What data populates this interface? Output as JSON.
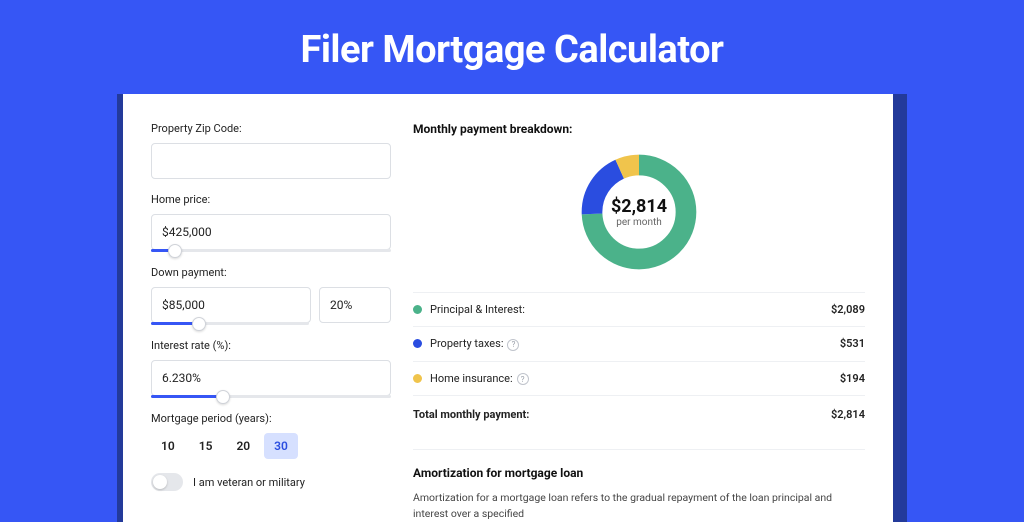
{
  "page_title": "Filer Mortgage Calculator",
  "form": {
    "zip_label": "Property Zip Code:",
    "zip_value": "",
    "home_price_label": "Home price:",
    "home_price_value": "$425,000",
    "home_price_slider_pct": 10,
    "down_payment_label": "Down payment:",
    "down_payment_value": "$85,000",
    "down_payment_pct": "20%",
    "down_payment_slider_pct": 20,
    "interest_label": "Interest rate (%):",
    "interest_value": "6.230%",
    "interest_slider_pct": 30,
    "period_label": "Mortgage period (years):",
    "periods": [
      "10",
      "15",
      "20",
      "30"
    ],
    "period_selected": "30",
    "veteran_label": "I am veteran or military",
    "veteran_on": false
  },
  "breakdown": {
    "title": "Monthly payment breakdown:",
    "center_value": "$2,814",
    "center_sub": "per month",
    "rows": [
      {
        "color": "green",
        "label": "Principal & Interest:",
        "value": "$2,089",
        "info": false
      },
      {
        "color": "blue",
        "label": "Property taxes:",
        "value": "$531",
        "info": true
      },
      {
        "color": "yellow",
        "label": "Home insurance:",
        "value": "$194",
        "info": true
      }
    ],
    "total_label": "Total monthly payment:",
    "total_value": "$2,814"
  },
  "chart_data": {
    "type": "pie",
    "title": "Monthly payment breakdown",
    "series": [
      {
        "name": "Principal & Interest",
        "value": 2089,
        "color": "#4bb28a"
      },
      {
        "name": "Property taxes",
        "value": 531,
        "color": "#2a4de0"
      },
      {
        "name": "Home insurance",
        "value": 194,
        "color": "#f0c44c"
      }
    ],
    "total": 2814,
    "unit": "USD per month"
  },
  "amortization": {
    "title": "Amortization for mortgage loan",
    "body": "Amortization for a mortgage loan refers to the gradual repayment of the loan principal and interest over a specified"
  }
}
